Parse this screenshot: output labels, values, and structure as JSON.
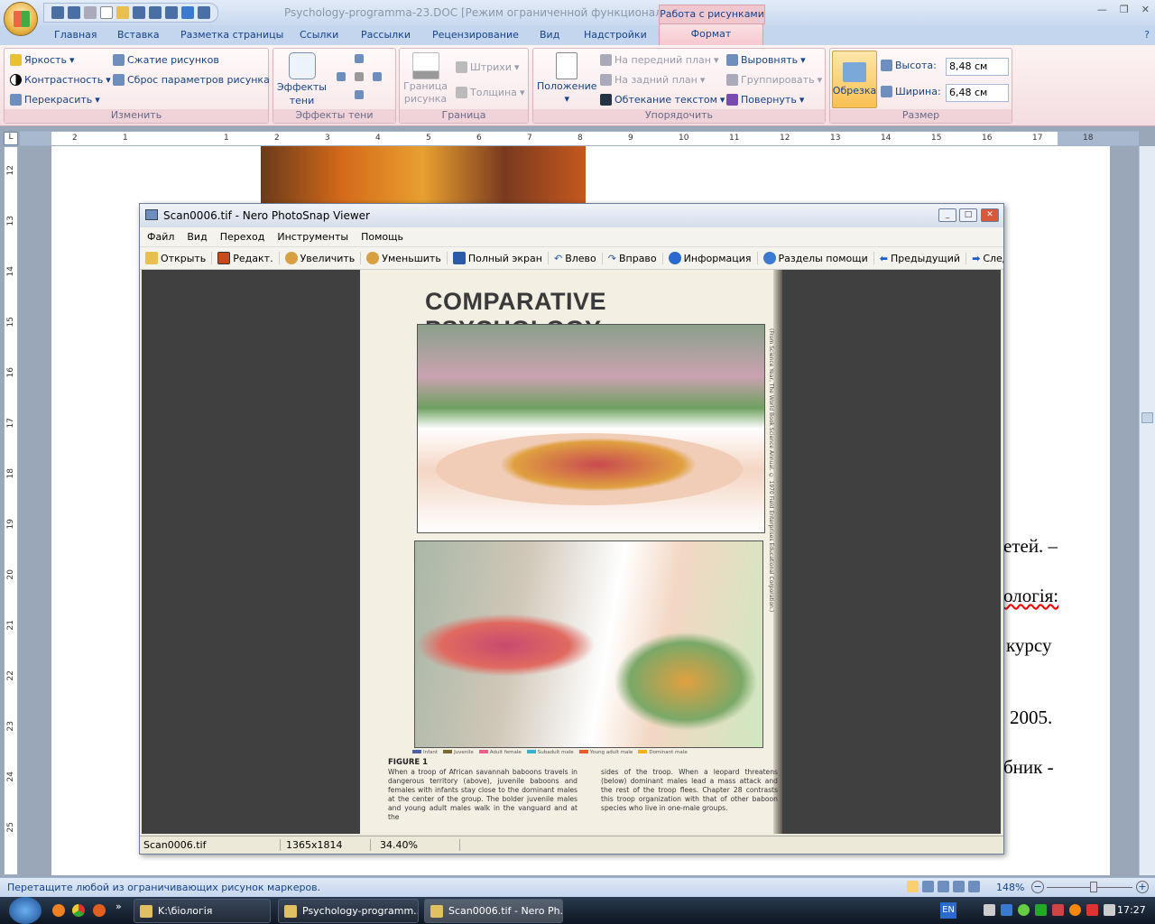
{
  "word": {
    "title": "Psychology-programma-23.DOC [Режим ограниченной функциональн...  M",
    "context_tab_group": "Работа с рисунками",
    "tabs": [
      "Главная",
      "Вставка",
      "Разметка страницы",
      "Ссылки",
      "Рассылки",
      "Рецензирование",
      "Вид",
      "Надстройки",
      "Формат"
    ],
    "ribbon": {
      "adjust": {
        "label": "Изменить",
        "brightness": "Яркость",
        "contrast": "Контрастность",
        "recolor": "Перекрасить",
        "compress": "Сжатие рисунков",
        "reset": "Сброс параметров рисунка"
      },
      "shadow": {
        "label": "Эффекты тени",
        "effects_line1": "Эффекты",
        "effects_line2": "тени"
      },
      "border": {
        "label": "Граница",
        "border_line1": "Граница",
        "border_line2": "рисунка",
        "dashes": "Штрихи",
        "weight": "Толщина"
      },
      "arrange": {
        "label": "Упорядочить",
        "position": "Положение",
        "bring_front": "На передний план",
        "send_back": "На задний план",
        "wrap": "Обтекание текстом",
        "align": "Выровнять",
        "group": "Группировать",
        "rotate": "Повернуть"
      },
      "size": {
        "label": "Размер",
        "crop": "Обрезка",
        "height_label": "Высота:",
        "height_value": "8,48 см",
        "width_label": "Ширина:",
        "width_value": "6,48 см"
      }
    },
    "ruler_numbers": [
      "2",
      "1",
      "",
      "1",
      "2",
      "3",
      "4",
      "5",
      "6",
      "7",
      "8",
      "9",
      "10",
      "11",
      "12",
      "13",
      "14",
      "15",
      "16",
      "17",
      "18"
    ],
    "vruler_numbers": [
      "12",
      "13",
      "14",
      "15",
      "16",
      "17",
      "18",
      "19",
      "20",
      "21",
      "22",
      "23",
      "24",
      "25"
    ],
    "doc_fragments": [
      "етей. –",
      "ологія:",
      "курсу",
      "2005.",
      "бник -"
    ],
    "status_text": "Перетащите любой из ограничивающих рисунок маркеров.",
    "zoom": "148%"
  },
  "nero": {
    "title": "Scan0006.tif - Nero PhotoSnap Viewer",
    "menu": [
      "Файл",
      "Вид",
      "Переход",
      "Инструменты",
      "Помощь"
    ],
    "toolbar": [
      "Открыть",
      "Редакт.",
      "Увеличить",
      "Уменьшить",
      "Полный экран",
      "Влево",
      "Вправо",
      "Информация",
      "Разделы помощи",
      "Предыдущий",
      "Следующ"
    ],
    "status": {
      "file": "Scan0006.tif",
      "dims": "1365x1814",
      "zoom": "34.40%"
    },
    "scan": {
      "title": "COMPARATIVE PSYCHOLOGY",
      "credit": "(From Science Year, The World Book Science Annual. © 1970 Field Enterprises Educational Corporation.)",
      "legend": [
        {
          "label": "Infant",
          "color": "#4a5fa8"
        },
        {
          "label": "Juvenile",
          "color": "#7a6a30"
        },
        {
          "label": "Adult female",
          "color": "#e8608a"
        },
        {
          "label": "Subadult male",
          "color": "#38b0d0"
        },
        {
          "label": "Young adult male",
          "color": "#e85a2a"
        },
        {
          "label": "Dominant male",
          "color": "#f0b020"
        }
      ],
      "figure_label": "FIGURE 1",
      "caption_left": "When a troop of African savannah baboons travels in dangerous territory (above), juvenile baboons and females with infants stay close to the dominant males at the center of the group. The bolder juvenile males and young adult males walk in the vanguard and at the",
      "caption_right": "sides of the troop. When a leopard threatens (below) dominant males lead a mass attack and the rest of the troop flees. Chapter 28 contrasts this troop organization with that of other baboon species who live in one-male groups."
    }
  },
  "taskbar": {
    "items": [
      "K:\\біологія",
      "Psychology-programm...",
      "Scan0006.tif - Nero Ph..."
    ],
    "lang": "EN",
    "time": "17:27",
    "more": "»"
  }
}
